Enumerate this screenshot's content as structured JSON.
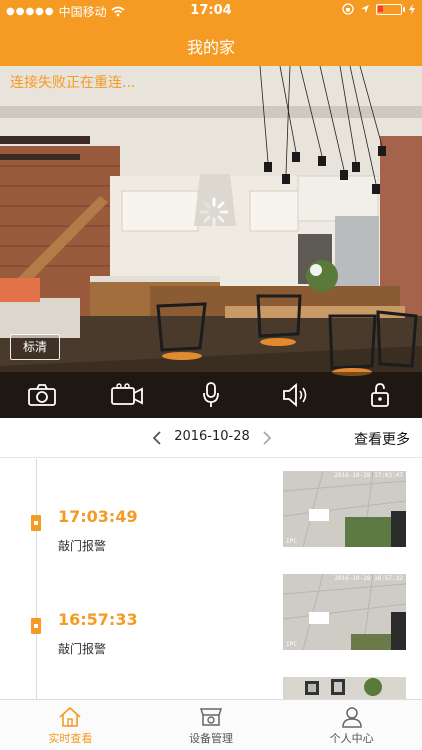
{
  "status_bar": {
    "carrier": "中国移动",
    "time": "17:04"
  },
  "header": {
    "title": "我的家"
  },
  "video": {
    "connection_status": "连接失败正在重连...",
    "quality_label": "标清",
    "controls": [
      {
        "icon": "camera-icon"
      },
      {
        "icon": "video-record-icon"
      },
      {
        "icon": "microphone-icon"
      },
      {
        "icon": "speaker-icon"
      },
      {
        "icon": "unlock-icon"
      }
    ]
  },
  "date_bar": {
    "date": "2016-10-28",
    "more_label": "查看更多"
  },
  "events": [
    {
      "time": "17:03:49",
      "label": "敲门报警",
      "thumb_timestamp": "2016-10-28 17:03:47",
      "thumb_watermark": "IPC"
    },
    {
      "time": "16:57:33",
      "label": "敲门报警",
      "thumb_timestamp": "2016-10-28 16:57:32",
      "thumb_watermark": "IPC"
    },
    {
      "time": "",
      "label": "",
      "thumb_timestamp": "",
      "thumb_watermark": ""
    }
  ],
  "tabbar": {
    "items": [
      {
        "label": "实时查看",
        "icon": "home-icon",
        "active": true
      },
      {
        "label": "设备管理",
        "icon": "device-manage-icon",
        "active": false
      },
      {
        "label": "个人中心",
        "icon": "user-icon",
        "active": false
      }
    ]
  },
  "colors": {
    "accent": "#f59a23",
    "battery": "#ff3b30"
  }
}
